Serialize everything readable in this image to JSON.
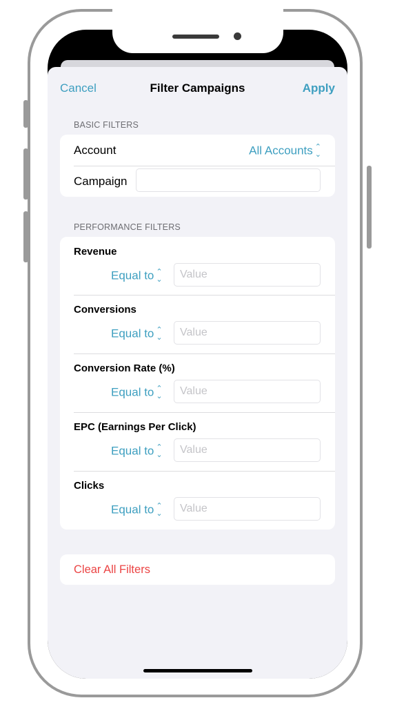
{
  "nav": {
    "cancel_label": "Cancel",
    "title": "Filter Campaigns",
    "apply_label": "Apply"
  },
  "basic_filters": {
    "header": "BASIC FILTERS",
    "account_label": "Account",
    "account_value": "All Accounts",
    "campaign_label": "Campaign",
    "campaign_value": ""
  },
  "performance_filters": {
    "header": "PERFORMANCE FILTERS",
    "items": [
      {
        "label": "Revenue",
        "operator": "Equal to",
        "placeholder": "Value"
      },
      {
        "label": "Conversions",
        "operator": "Equal to",
        "placeholder": "Value"
      },
      {
        "label": "Conversion Rate (%)",
        "operator": "Equal to",
        "placeholder": "Value"
      },
      {
        "label": "EPC (Earnings Per Click)",
        "operator": "Equal to",
        "placeholder": "Value"
      },
      {
        "label": "Clicks",
        "operator": "Equal to",
        "placeholder": "Value"
      }
    ]
  },
  "clear_all_label": "Clear All Filters",
  "icons": {
    "picker": "chevron-up-down-icon"
  },
  "colors": {
    "accent": "#3e9fc0",
    "destructive": "#eb4444",
    "background": "#f2f2f7"
  }
}
